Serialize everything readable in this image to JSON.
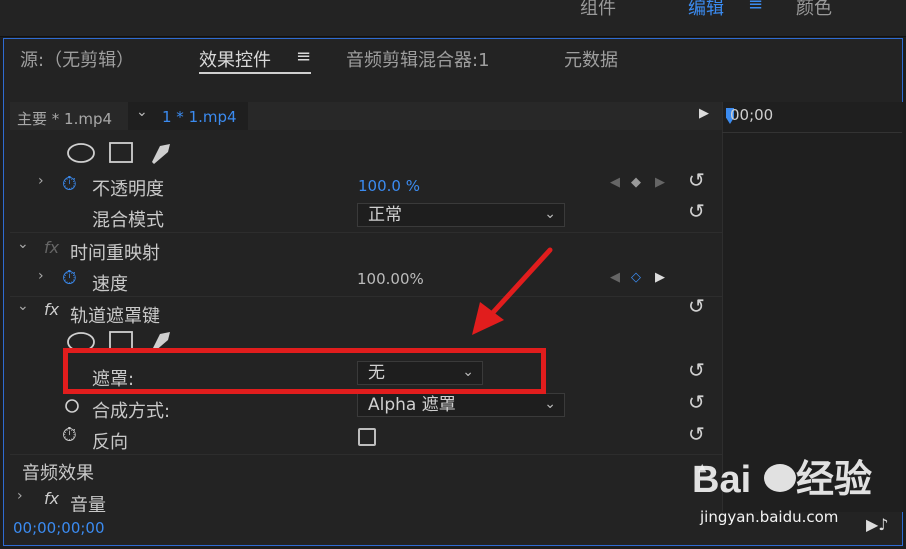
{
  "topbar": {
    "workspaces": [
      "组件",
      "编辑",
      "颜色"
    ],
    "active_workspace": "编辑"
  },
  "tabs": [
    {
      "label": "源:（无剪辑）"
    },
    {
      "label": "效果控件"
    },
    {
      "label": "音频剪辑混合器:1"
    },
    {
      "label": "元数据"
    }
  ],
  "active_tab": "效果控件",
  "clip": {
    "master": "主要 * 1.mp4",
    "sequence": "1 * 1.mp4"
  },
  "timeline": {
    "timecode": "00;00"
  },
  "rows": {
    "opacity": {
      "label": "不透明度",
      "value": "100.0 %"
    },
    "blend_mode": {
      "label": "混合模式",
      "value": "正常"
    },
    "time_remap": {
      "label": "时间重映射"
    },
    "speed": {
      "label": "速度",
      "value": "100.00%"
    },
    "track_matte": {
      "label": "轨道遮罩键"
    },
    "matte": {
      "label": "遮罩:",
      "value": "无"
    },
    "composite": {
      "label": "合成方式:",
      "value": "Alpha 遮罩"
    },
    "reverse": {
      "label": "反向"
    },
    "audio_effects": {
      "label": "音频效果"
    },
    "volume": {
      "label": "音量"
    }
  },
  "footer": {
    "timecode": "00;00;00;00"
  },
  "watermark": {
    "site": "jingyan.baidu.com",
    "logo_text": "Baidu 经验"
  },
  "annotation": {
    "box_color": "#e11d1d",
    "arrow_color": "#e11d1d"
  }
}
